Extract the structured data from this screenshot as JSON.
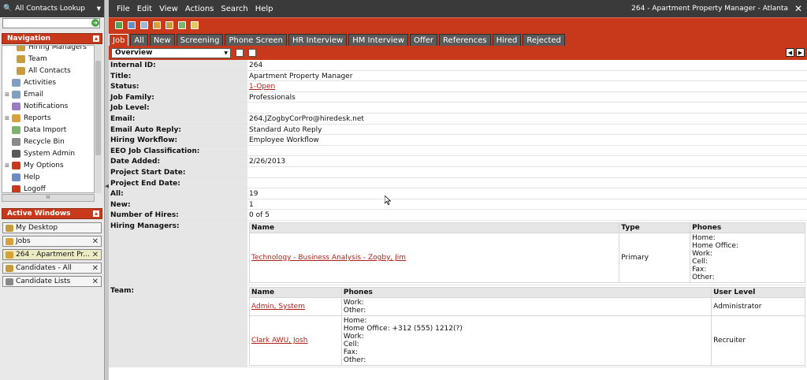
{
  "lookup": {
    "title": "All Contacts Lookup"
  },
  "navigation": {
    "title": "Navigation",
    "items": [
      {
        "label": "Hiring Managers",
        "color": "#c89b3c",
        "sub": true,
        "exp": ""
      },
      {
        "label": "Team",
        "color": "#c89b3c",
        "sub": true,
        "exp": ""
      },
      {
        "label": "All Contacts",
        "color": "#c89b3c",
        "sub": true,
        "exp": ""
      },
      {
        "label": "Activities",
        "color": "#7f9fc4",
        "sub": false,
        "exp": ""
      },
      {
        "label": "Email",
        "color": "#7f9fc4",
        "sub": false,
        "exp": "+"
      },
      {
        "label": "Notifications",
        "color": "#9b7cc4",
        "sub": false,
        "exp": ""
      },
      {
        "label": "Reports",
        "color": "#d9a13b",
        "sub": false,
        "exp": "+"
      },
      {
        "label": "Data Import",
        "color": "#7fb26a",
        "sub": false,
        "exp": ""
      },
      {
        "label": "Recycle Bin",
        "color": "#8a8a8a",
        "sub": false,
        "exp": ""
      },
      {
        "label": "System Admin",
        "color": "#5a5a5a",
        "sub": false,
        "exp": ""
      },
      {
        "label": "My Options",
        "color": "#c8391b",
        "sub": false,
        "exp": "+"
      },
      {
        "label": "Help",
        "color": "#6a8ec4",
        "sub": false,
        "exp": ""
      },
      {
        "label": "Logoff",
        "color": "#c8391b",
        "sub": false,
        "exp": ""
      }
    ]
  },
  "active_windows": {
    "title": "Active Windows",
    "items": [
      {
        "label": "My Desktop",
        "color": "#c89b3c",
        "closable": false,
        "active": false
      },
      {
        "label": "Jobs",
        "color": "#d9a13b",
        "closable": true,
        "active": false
      },
      {
        "label": "264 - Apartment Pr...",
        "color": "#d9a13b",
        "closable": true,
        "active": true
      },
      {
        "label": "Candidates - All",
        "color": "#c89b3c",
        "closable": true,
        "active": false
      },
      {
        "label": "Candidate Lists",
        "color": "#888888",
        "closable": true,
        "active": false
      }
    ]
  },
  "menu": [
    "File",
    "Edit",
    "View",
    "Actions",
    "Search",
    "Help"
  ],
  "window_title": "264 - Apartment Property Manager - Atlanta",
  "tabs": [
    "Job",
    "All",
    "New",
    "Screening",
    "Phone Screen",
    "HR Interview",
    "HM Interview",
    "Offer",
    "References",
    "Hired",
    "Rejected"
  ],
  "view_select": "Overview",
  "fields": [
    {
      "label": "Internal ID:",
      "value": "264",
      "link": false
    },
    {
      "label": "Title:",
      "value": "Apartment Property Manager",
      "link": false
    },
    {
      "label": "Status:",
      "value": "1-Open",
      "link": true
    },
    {
      "label": "Job Family:",
      "value": "Professionals",
      "link": false
    },
    {
      "label": "Job Level:",
      "value": "",
      "link": false
    },
    {
      "label": "Email:",
      "value": "264.JZogbyCorPro@hiredesk.net",
      "link": false
    },
    {
      "label": "Email Auto Reply:",
      "value": "Standard Auto Reply",
      "link": false
    },
    {
      "label": "Hiring Workflow:",
      "value": "Employee Workflow",
      "link": false
    },
    {
      "label": "EEO Job Classification:",
      "value": "",
      "link": false
    },
    {
      "label": "Date Added:",
      "value": "2/26/2013",
      "link": false
    },
    {
      "label": "Project Start Date:",
      "value": "",
      "link": false
    },
    {
      "label": "Project End Date:",
      "value": "",
      "link": false
    },
    {
      "label": "All:",
      "value": "19",
      "link": false
    },
    {
      "label": "New:",
      "value": "1",
      "link": false
    },
    {
      "label": "Number of Hires:",
      "value": "0 of 5",
      "link": false
    }
  ],
  "hiring_managers": {
    "label": "Hiring Managers:",
    "headers": [
      "Name",
      "Type",
      "Phones"
    ],
    "rows": [
      {
        "name": "Technology - Business Analysis - Zogby, Jim",
        "type": "Primary",
        "phones": [
          "Home:",
          "Home Office:",
          "Work:",
          "Cell:",
          "Fax:",
          "Other:"
        ]
      }
    ]
  },
  "team": {
    "label": "Team:",
    "headers": [
      "Name",
      "Phones",
      "User Level"
    ],
    "rows": [
      {
        "name": "Admin, System",
        "phones": [
          "Work:",
          "Other:"
        ],
        "level": "Administrator"
      },
      {
        "name": "Clark AWU, Josh",
        "phones": [
          "Home:",
          "Home Office: +312 (555) 1212(?)",
          "Work:",
          "Cell:",
          "Fax:",
          "Other:"
        ],
        "level": "Recruiter"
      }
    ]
  }
}
